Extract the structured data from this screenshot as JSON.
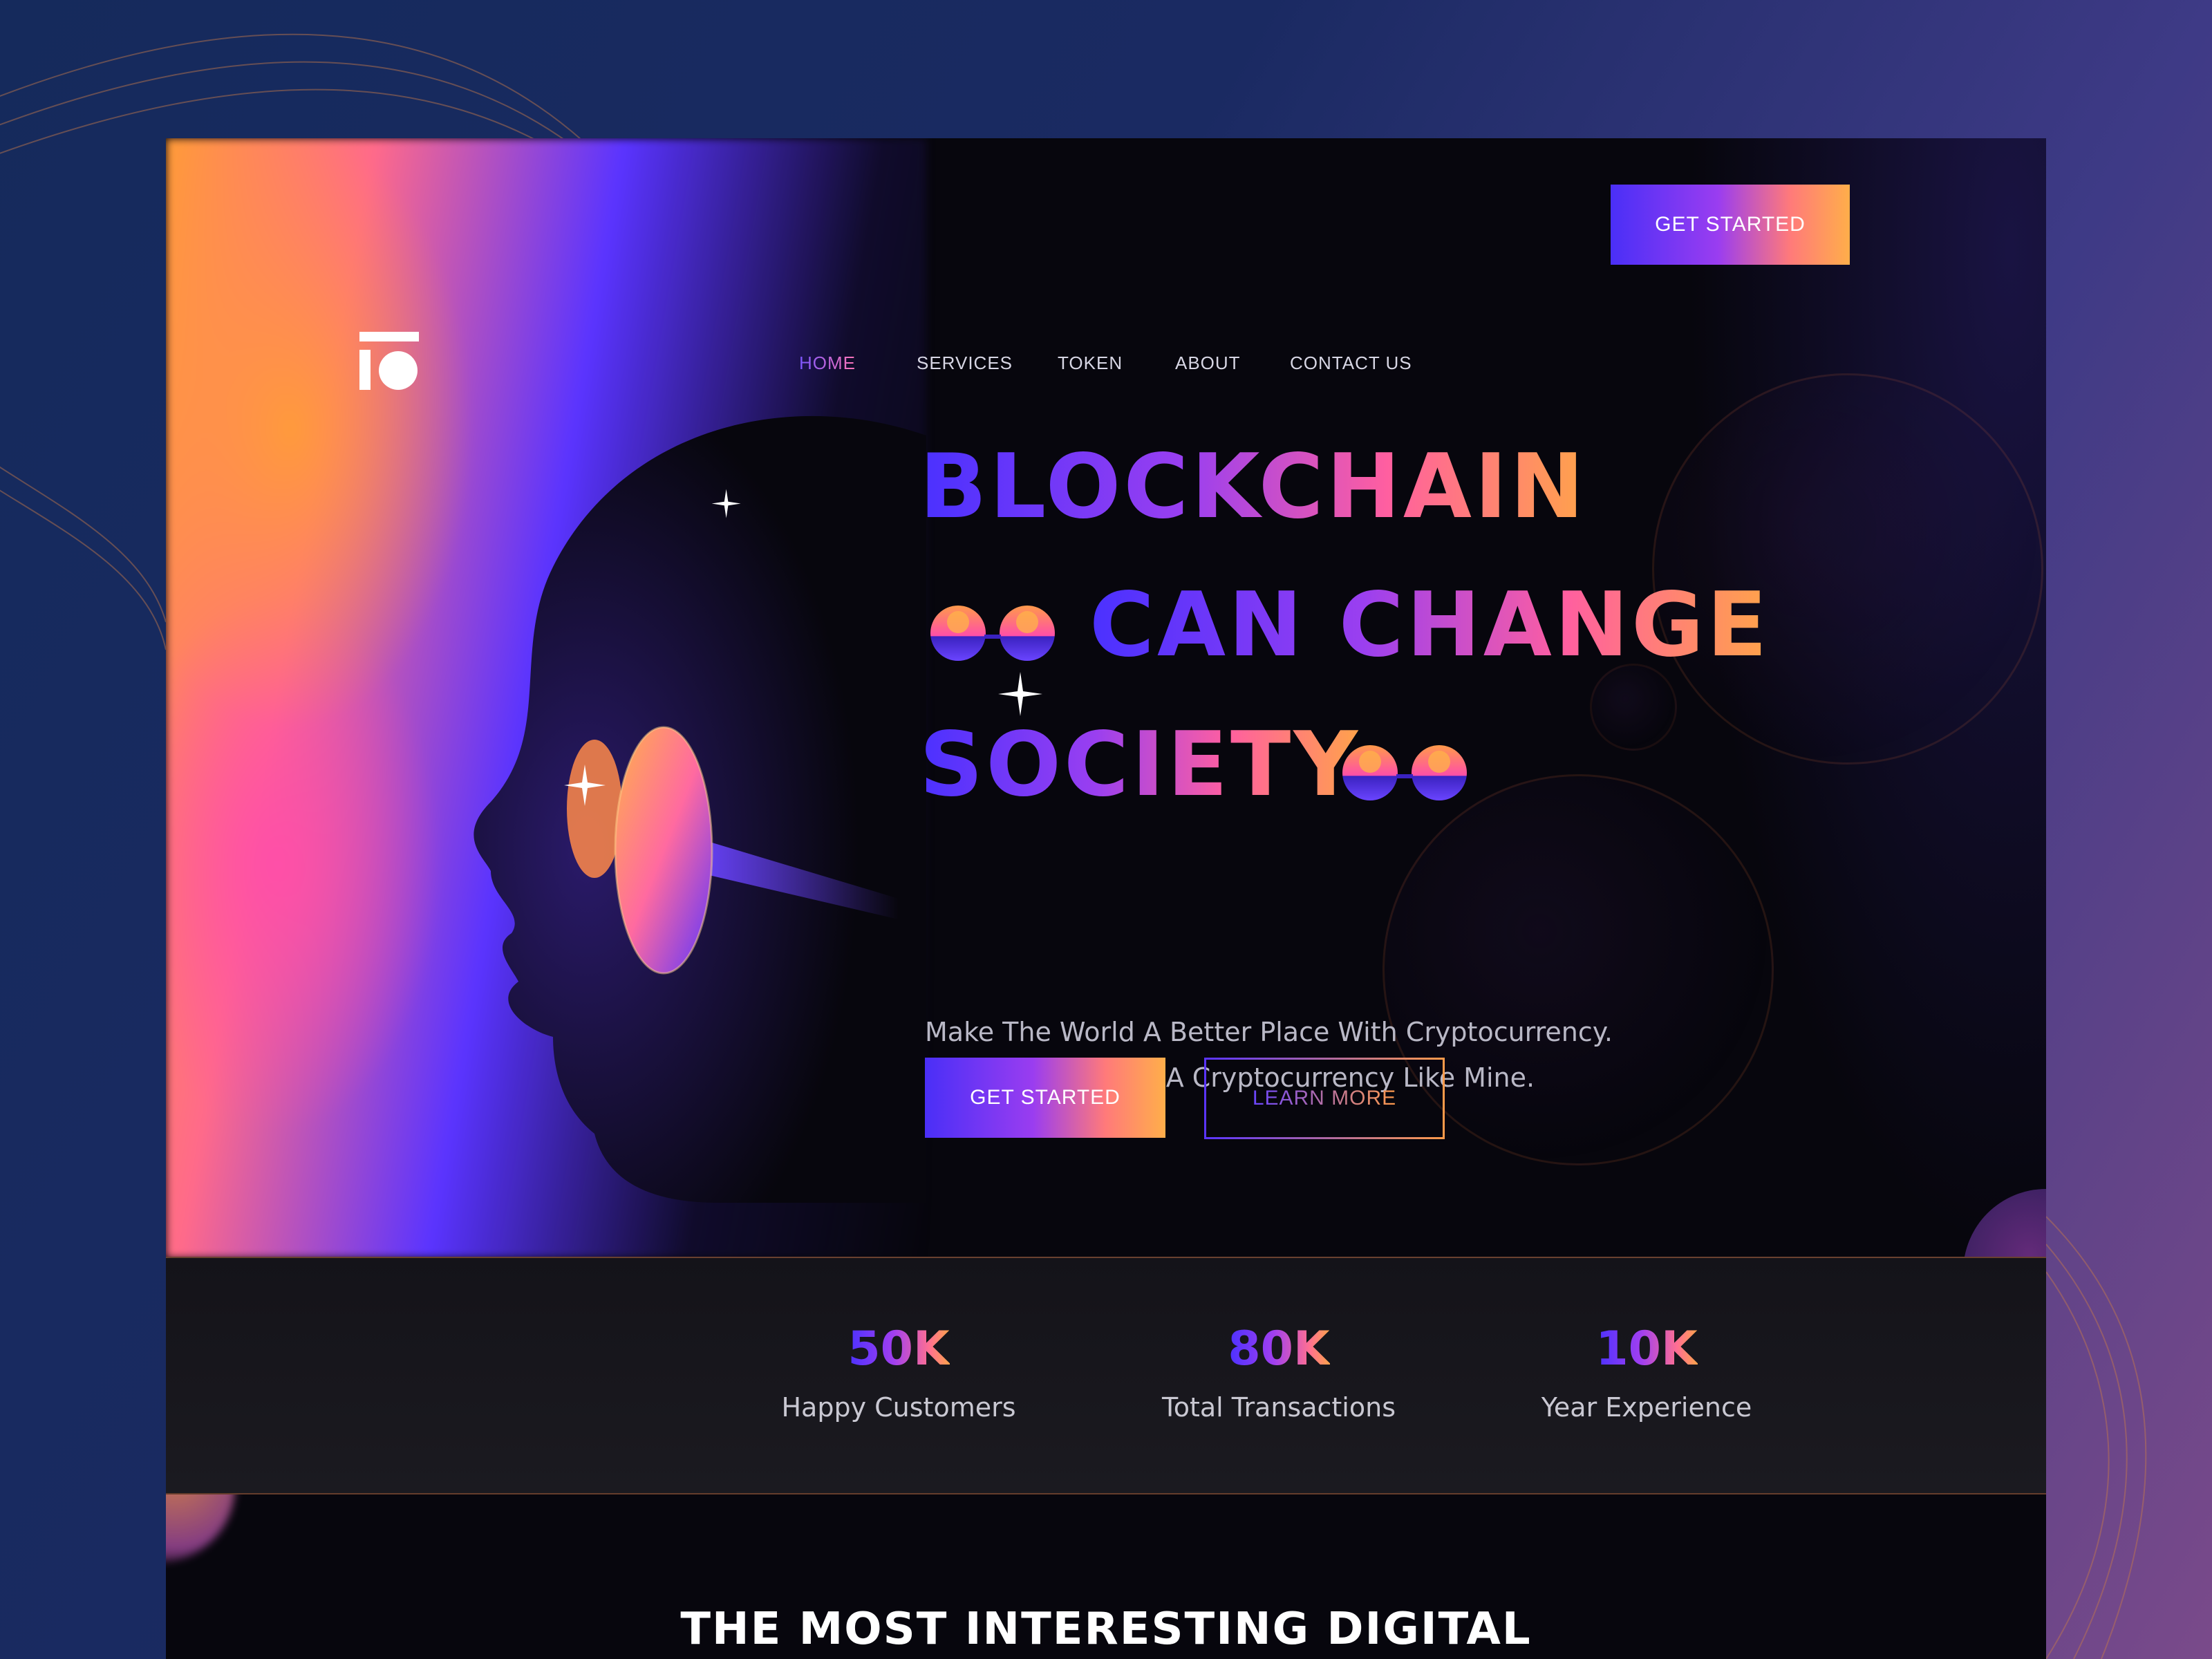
{
  "brand": {
    "logo_icon": "brand-logo-icon"
  },
  "nav": {
    "items": [
      {
        "label": "HOME",
        "active": true
      },
      {
        "label": "SERVICES",
        "active": false
      },
      {
        "label": "TOKEN",
        "active": false
      },
      {
        "label": "ABOUT",
        "active": false
      },
      {
        "label": "CONTACT US",
        "active": false
      }
    ],
    "cta_label": "GET STARTED"
  },
  "hero": {
    "headline": {
      "line1": "BLOCKCHAIN",
      "line2": "CAN CHANGE",
      "line3": "SOCIETY"
    },
    "subtitle": {
      "line1": "Make The World A Better Place With Cryptocurrency.",
      "line2": "You Too Can Have A Cryptocurrency Like Mine."
    },
    "primary_button": "GET STARTED",
    "secondary_button": "LEARN MORE",
    "emoji_icon": "sunglasses-icon"
  },
  "stats": [
    {
      "value": "50K",
      "label": "Happy Customers"
    },
    {
      "value": "80K",
      "label": "Total Transactions"
    },
    {
      "value": "10K",
      "label": "Year Experience"
    }
  ],
  "section": {
    "title": "THE MOST INTERESTING DIGITAL"
  },
  "colors": {
    "gradient_start": "#4a31ff",
    "gradient_mid": "#ff5fa0",
    "gradient_end": "#ffa34a",
    "card_bg": "#07060d",
    "page_bg": "#152a5c"
  }
}
